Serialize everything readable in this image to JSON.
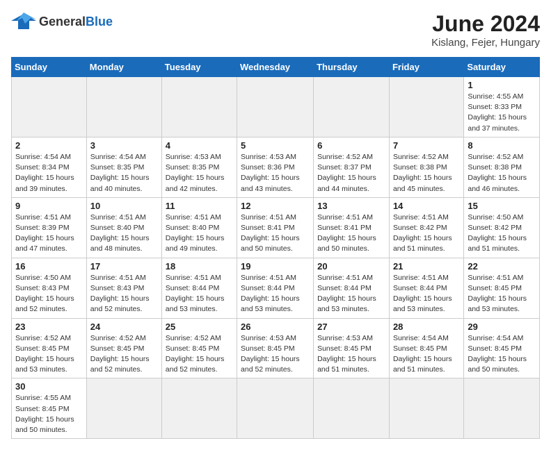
{
  "header": {
    "logo_general": "General",
    "logo_blue": "Blue",
    "month_title": "June 2024",
    "location": "Kislang, Fejer, Hungary"
  },
  "weekdays": [
    "Sunday",
    "Monday",
    "Tuesday",
    "Wednesday",
    "Thursday",
    "Friday",
    "Saturday"
  ],
  "days": {
    "d1": {
      "n": "1",
      "sr": "4:55 AM",
      "ss": "8:33 PM",
      "dl": "15 hours and 37 minutes."
    },
    "d2": {
      "n": "2",
      "sr": "4:54 AM",
      "ss": "8:34 PM",
      "dl": "15 hours and 39 minutes."
    },
    "d3": {
      "n": "3",
      "sr": "4:54 AM",
      "ss": "8:35 PM",
      "dl": "15 hours and 40 minutes."
    },
    "d4": {
      "n": "4",
      "sr": "4:53 AM",
      "ss": "8:35 PM",
      "dl": "15 hours and 42 minutes."
    },
    "d5": {
      "n": "5",
      "sr": "4:53 AM",
      "ss": "8:36 PM",
      "dl": "15 hours and 43 minutes."
    },
    "d6": {
      "n": "6",
      "sr": "4:52 AM",
      "ss": "8:37 PM",
      "dl": "15 hours and 44 minutes."
    },
    "d7": {
      "n": "7",
      "sr": "4:52 AM",
      "ss": "8:38 PM",
      "dl": "15 hours and 45 minutes."
    },
    "d8": {
      "n": "8",
      "sr": "4:52 AM",
      "ss": "8:38 PM",
      "dl": "15 hours and 46 minutes."
    },
    "d9": {
      "n": "9",
      "sr": "4:51 AM",
      "ss": "8:39 PM",
      "dl": "15 hours and 47 minutes."
    },
    "d10": {
      "n": "10",
      "sr": "4:51 AM",
      "ss": "8:40 PM",
      "dl": "15 hours and 48 minutes."
    },
    "d11": {
      "n": "11",
      "sr": "4:51 AM",
      "ss": "8:40 PM",
      "dl": "15 hours and 49 minutes."
    },
    "d12": {
      "n": "12",
      "sr": "4:51 AM",
      "ss": "8:41 PM",
      "dl": "15 hours and 50 minutes."
    },
    "d13": {
      "n": "13",
      "sr": "4:51 AM",
      "ss": "8:41 PM",
      "dl": "15 hours and 50 minutes."
    },
    "d14": {
      "n": "14",
      "sr": "4:51 AM",
      "ss": "8:42 PM",
      "dl": "15 hours and 51 minutes."
    },
    "d15": {
      "n": "15",
      "sr": "4:50 AM",
      "ss": "8:42 PM",
      "dl": "15 hours and 51 minutes."
    },
    "d16": {
      "n": "16",
      "sr": "4:50 AM",
      "ss": "8:43 PM",
      "dl": "15 hours and 52 minutes."
    },
    "d17": {
      "n": "17",
      "sr": "4:51 AM",
      "ss": "8:43 PM",
      "dl": "15 hours and 52 minutes."
    },
    "d18": {
      "n": "18",
      "sr": "4:51 AM",
      "ss": "8:44 PM",
      "dl": "15 hours and 53 minutes."
    },
    "d19": {
      "n": "19",
      "sr": "4:51 AM",
      "ss": "8:44 PM",
      "dl": "15 hours and 53 minutes."
    },
    "d20": {
      "n": "20",
      "sr": "4:51 AM",
      "ss": "8:44 PM",
      "dl": "15 hours and 53 minutes."
    },
    "d21": {
      "n": "21",
      "sr": "4:51 AM",
      "ss": "8:44 PM",
      "dl": "15 hours and 53 minutes."
    },
    "d22": {
      "n": "22",
      "sr": "4:51 AM",
      "ss": "8:45 PM",
      "dl": "15 hours and 53 minutes."
    },
    "d23": {
      "n": "23",
      "sr": "4:52 AM",
      "ss": "8:45 PM",
      "dl": "15 hours and 53 minutes."
    },
    "d24": {
      "n": "24",
      "sr": "4:52 AM",
      "ss": "8:45 PM",
      "dl": "15 hours and 52 minutes."
    },
    "d25": {
      "n": "25",
      "sr": "4:52 AM",
      "ss": "8:45 PM",
      "dl": "15 hours and 52 minutes."
    },
    "d26": {
      "n": "26",
      "sr": "4:53 AM",
      "ss": "8:45 PM",
      "dl": "15 hours and 52 minutes."
    },
    "d27": {
      "n": "27",
      "sr": "4:53 AM",
      "ss": "8:45 PM",
      "dl": "15 hours and 51 minutes."
    },
    "d28": {
      "n": "28",
      "sr": "4:54 AM",
      "ss": "8:45 PM",
      "dl": "15 hours and 51 minutes."
    },
    "d29": {
      "n": "29",
      "sr": "4:54 AM",
      "ss": "8:45 PM",
      "dl": "15 hours and 50 minutes."
    },
    "d30": {
      "n": "30",
      "sr": "4:55 AM",
      "ss": "8:45 PM",
      "dl": "15 hours and 50 minutes."
    }
  },
  "labels": {
    "sunrise": "Sunrise:",
    "sunset": "Sunset:",
    "daylight": "Daylight:"
  }
}
